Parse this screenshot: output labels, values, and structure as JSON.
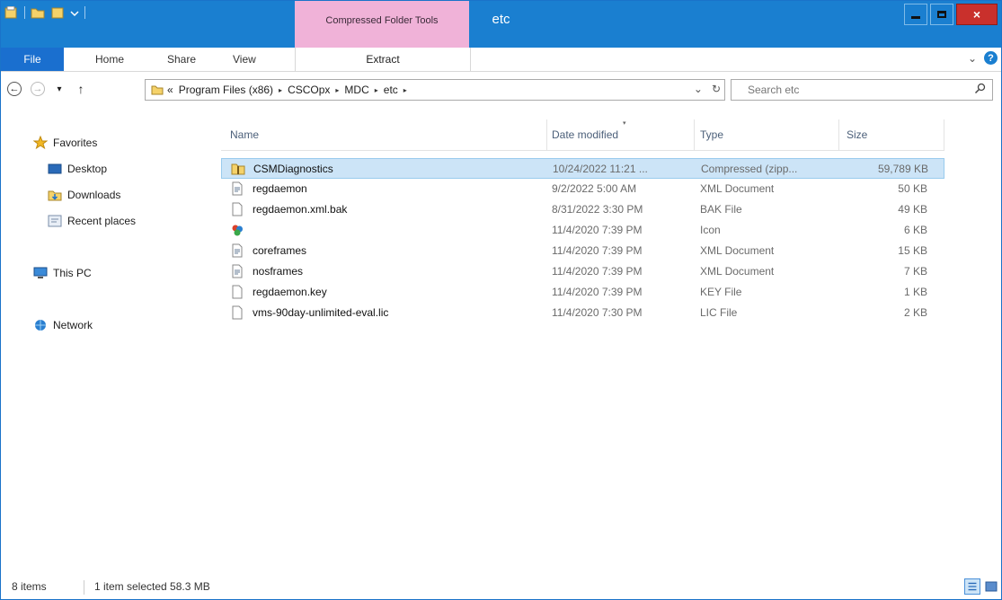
{
  "title_bar": {
    "window_title": "etc",
    "context_tab_title": "Compressed Folder Tools",
    "quick_access_icons": [
      "properties-icon",
      "new-folder-icon",
      "customize-chevron-icon"
    ],
    "buttons": {
      "minimize": "minimize-icon",
      "maximize": "maximize-icon",
      "close": "×"
    }
  },
  "ribbon": {
    "tabs": [
      {
        "label": "File",
        "active": true
      },
      {
        "label": "Home"
      },
      {
        "label": "Share"
      },
      {
        "label": "View"
      },
      {
        "label": "Extract"
      }
    ],
    "expand_glyph": "⌄",
    "help_glyph": "?"
  },
  "navigation": {
    "back": "←",
    "forward": "→",
    "recent_chevron": "▾",
    "up": "↑",
    "address": {
      "prefix": "«",
      "segments": [
        "Program Files (x86)",
        "CSCOpx",
        "MDC",
        "etc"
      ],
      "separator": "▸",
      "dropdown": "⌄",
      "refresh": "↻"
    },
    "search": {
      "placeholder": "Search etc",
      "icon": "search-icon"
    }
  },
  "nav_pane": {
    "favorites": {
      "label": "Favorites",
      "icon": "star-icon",
      "items": [
        {
          "label": "Desktop",
          "icon": "desktop-icon"
        },
        {
          "label": "Downloads",
          "icon": "downloads-icon"
        },
        {
          "label": "Recent places",
          "icon": "recent-places-icon"
        }
      ]
    },
    "this_pc": {
      "label": "This PC",
      "icon": "computer-icon"
    },
    "network": {
      "label": "Network",
      "icon": "network-icon"
    }
  },
  "file_list": {
    "columns": [
      "Name",
      "Date modified",
      "Type",
      "Size"
    ],
    "sorted_column": "Date modified",
    "rows": [
      {
        "name": "CSMDiagnostics",
        "date": "10/24/2022 11:21 ...",
        "type": "Compressed (zipp...",
        "size": "59,789 KB",
        "icon": "zip-folder-icon",
        "selected": true
      },
      {
        "name": "regdaemon",
        "date": "9/2/2022 5:00 AM",
        "type": "XML Document",
        "size": "50 KB",
        "icon": "xml-file-icon"
      },
      {
        "name": "regdaemon.xml.bak",
        "date": "8/31/2022 3:30 PM",
        "type": "BAK File",
        "size": "49 KB",
        "icon": "blank-file-icon"
      },
      {
        "name": "",
        "date": "11/4/2020 7:39 PM",
        "type": "Icon",
        "size": "6 KB",
        "icon": "app-icon-file-icon"
      },
      {
        "name": "coreframes",
        "date": "11/4/2020 7:39 PM",
        "type": "XML Document",
        "size": "15 KB",
        "icon": "xml-file-icon"
      },
      {
        "name": "nosframes",
        "date": "11/4/2020 7:39 PM",
        "type": "XML Document",
        "size": "7 KB",
        "icon": "xml-file-icon"
      },
      {
        "name": "regdaemon.key",
        "date": "11/4/2020 7:39 PM",
        "type": "KEY File",
        "size": "1 KB",
        "icon": "blank-file-icon"
      },
      {
        "name": "vms-90day-unlimited-eval.lic",
        "date": "11/4/2020 7:30 PM",
        "type": "LIC File",
        "size": "2 KB",
        "icon": "blank-file-icon"
      }
    ]
  },
  "status_bar": {
    "items_count": "8 items",
    "selection": "1 item selected  58.3 MB",
    "views": [
      "details-view-icon",
      "large-icons-view-icon"
    ],
    "active_view": "details-view-icon"
  },
  "colors": {
    "title_bar": "#1a7fd0",
    "context_tab": "#f0b2d8",
    "selection": "#cce4f7",
    "file_tab": "#1a6fcf"
  }
}
